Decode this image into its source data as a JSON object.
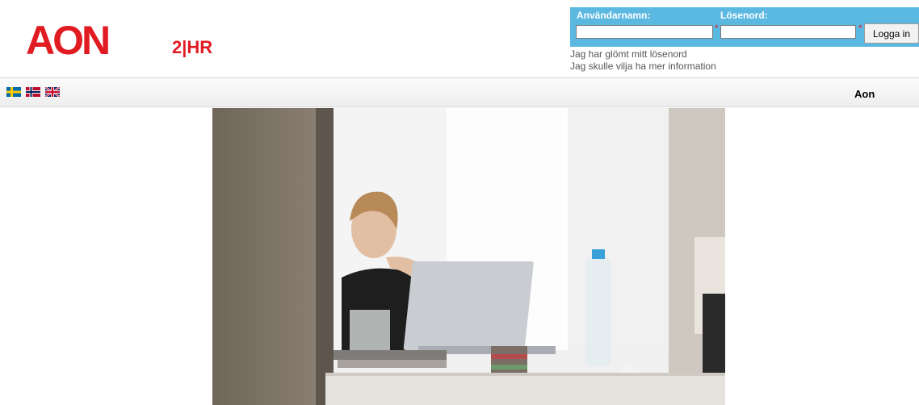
{
  "header": {
    "logo_text": "AON",
    "product_text": "2|HR"
  },
  "login": {
    "username_label": "Användarnamn:",
    "password_label": "Lösenord:",
    "username_value": "",
    "password_value": "",
    "required_marker": "*",
    "submit_label": "Logga in"
  },
  "links": {
    "forgot_password": "Jag har glömt mitt lösenord",
    "more_info": "Jag skulle vilja ha mer information"
  },
  "nav": {
    "languages": [
      "swedish-flag",
      "norwegian-flag",
      "british-flag"
    ],
    "company": "Aon"
  },
  "colors": {
    "brand_red": "#e11b22",
    "login_blue": "#5bb8e0"
  }
}
